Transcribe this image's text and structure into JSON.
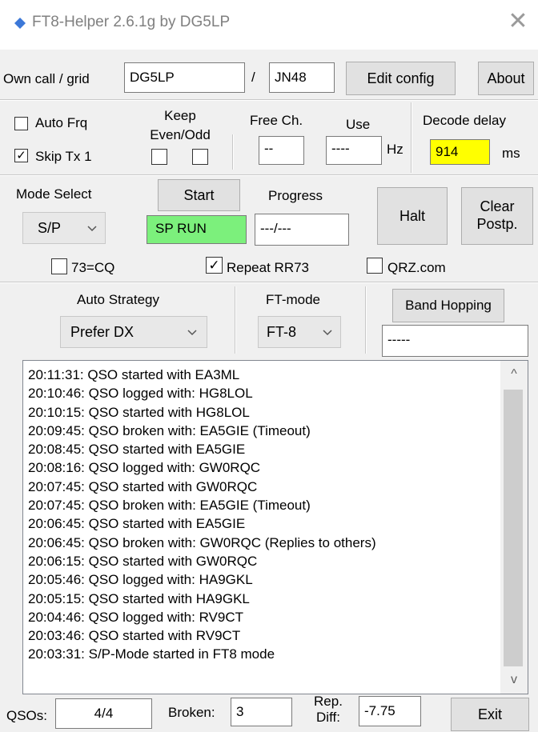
{
  "window": {
    "title": "FT8-Helper 2.6.1g by DG5LP",
    "icon": "diamond-icon",
    "close_glyph": "✕"
  },
  "row1": {
    "own_call_label": "Own call / grid",
    "callsign": "DG5LP",
    "slash": "/",
    "grid": "JN48",
    "edit_config": "Edit config",
    "about": "About"
  },
  "row2": {
    "auto_frq": "Auto Frq",
    "auto_frq_checked": "",
    "skip_tx1": "Skip Tx 1",
    "skip_tx1_checked": "✓",
    "keep_label": "Keep",
    "even_odd_label": "Even/Odd",
    "free_ch_label": "Free Ch.",
    "free_ch_value": "--",
    "use_label": "Use",
    "use_value": "----",
    "hz": "Hz",
    "decode_delay_label": "Decode delay",
    "decode_delay_value": "914",
    "ms": "ms"
  },
  "row3": {
    "mode_select_label": "Mode Select",
    "mode_value": "S/P",
    "start": "Start",
    "status": "SP RUN",
    "progress_label": "Progress",
    "progress_value": "---/---",
    "halt": "Halt",
    "clear_line1": "Clear",
    "clear_line2": "Postp.",
    "cq73": "73=CQ",
    "cq73_checked": "",
    "repeat_rr73": "Repeat RR73",
    "repeat_rr73_checked": "✓",
    "qrz": "QRZ.com",
    "qrz_checked": ""
  },
  "row4": {
    "auto_strategy_label": "Auto Strategy",
    "strategy_value": "Prefer DX",
    "ft_mode_label": "FT-mode",
    "ft_mode_value": "FT-8",
    "band_hopping": "Band Hopping",
    "band_value": "-----"
  },
  "log": [
    "20:11:31: QSO started with EA3ML",
    "20:10:46: QSO logged with: HG8LOL",
    "20:10:15: QSO started with HG8LOL",
    "20:09:45: QSO broken with: EA5GIE (Timeout)",
    "20:08:45: QSO started with EA5GIE",
    "20:08:16: QSO logged with: GW0RQC",
    "20:07:45: QSO started with GW0RQC",
    "20:07:45: QSO broken with: EA5GIE (Timeout)",
    "20:06:45: QSO started with EA5GIE",
    "20:06:45: QSO broken with: GW0RQC (Replies to others)",
    "20:06:15: QSO started with GW0RQC",
    "20:05:46: QSO logged with: HA9GKL",
    "20:05:15: QSO started with HA9GKL",
    "20:04:46: QSO logged with: RV9CT",
    "20:03:46: QSO started with RV9CT",
    "20:03:31: S/P-Mode started in FT8 mode"
  ],
  "scroll": {
    "up": "^",
    "down": "v"
  },
  "footer": {
    "qsos_label": "QSOs:",
    "qsos_value": "4/4",
    "broken_label": "Broken:",
    "broken_value": "3",
    "rep_diff_line1": "Rep.",
    "rep_diff_line2": "Diff:",
    "rep_diff_value": "-7.75",
    "exit": "Exit"
  },
  "colors": {
    "status_green": "#7cf07c",
    "decode_yellow": "#ffff00",
    "accent_diamond": "#3c78d8"
  }
}
